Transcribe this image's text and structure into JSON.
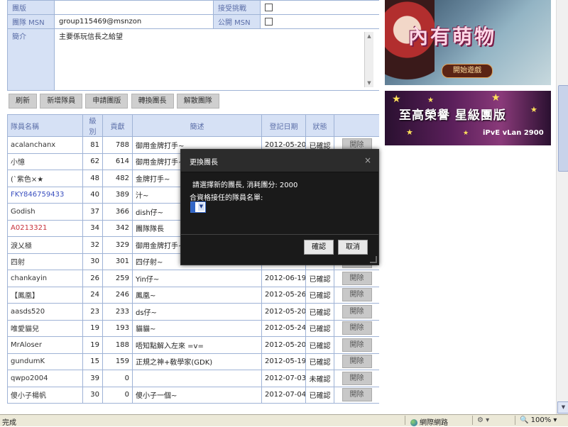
{
  "info": {
    "group_label": "團版",
    "group_value": "",
    "accept_challenge_label": "接受挑戰",
    "msn_label": "團隊 MSN",
    "msn_value": "group115469@msnzon",
    "public_msn_label": "公開 MSN",
    "intro_label": "簡介",
    "intro_value": "主要係玩信長之給望"
  },
  "toolbar": {
    "refresh": "刷新",
    "add_member": "新增隊員",
    "apply_board": "申請團版",
    "transfer_leader": "轉換團長",
    "disband": "解散團隊"
  },
  "members": {
    "headers": [
      "隊員名稱",
      "級別",
      "貢獻",
      "簡述",
      "登記日期",
      "狀態",
      ""
    ],
    "kick_label": "開除",
    "rows": [
      {
        "name": "acalanchanx",
        "level": "81",
        "contrib": "788",
        "desc": "御用金牌打手~",
        "date": "2012-05-20",
        "status": "已確認",
        "name_color": "#333333"
      },
      {
        "name": "小憶",
        "level": "62",
        "contrib": "614",
        "desc": "御用金牌打手~",
        "date": "",
        "status": "",
        "name_color": "#333333"
      },
      {
        "name": "(ˋ紫色×★",
        "level": "48",
        "contrib": "482",
        "desc": "金牌打手~",
        "date": "",
        "status": "",
        "name_color": "#333333"
      },
      {
        "name": "FKY846759433",
        "level": "40",
        "contrib": "389",
        "desc": "汁~",
        "date": "",
        "status": "",
        "name_color": "#3a4fbf"
      },
      {
        "name": "Godish",
        "level": "37",
        "contrib": "366",
        "desc": "dish仔~",
        "date": "",
        "status": "",
        "name_color": "#333333"
      },
      {
        "name": "A0213321",
        "level": "34",
        "contrib": "342",
        "desc": "團隊隊長",
        "date": "",
        "status": "",
        "name_color": "#c8323c"
      },
      {
        "name": "淚乂極",
        "level": "32",
        "contrib": "329",
        "desc": "御用金牌打手~",
        "date": "",
        "status": "",
        "name_color": "#333333"
      },
      {
        "name": "四射",
        "level": "30",
        "contrib": "301",
        "desc": "四仔射~",
        "date": "",
        "status": "",
        "name_color": "#333333"
      },
      {
        "name": "chankayin",
        "level": "26",
        "contrib": "259",
        "desc": "Yin仔~",
        "date": "2012-06-19",
        "status": "已確認",
        "name_color": "#333333"
      },
      {
        "name": "【鳳凰】",
        "level": "24",
        "contrib": "246",
        "desc": "鳳凰~",
        "date": "2012-05-26",
        "status": "已確認",
        "name_color": "#333333"
      },
      {
        "name": "aasds520",
        "level": "23",
        "contrib": "233",
        "desc": "ds仔~",
        "date": "2012-05-20",
        "status": "已確認",
        "name_color": "#333333"
      },
      {
        "name": "唯愛貓兒",
        "level": "19",
        "contrib": "193",
        "desc": "貓貓~",
        "date": "2012-05-24",
        "status": "已確認",
        "name_color": "#333333"
      },
      {
        "name": "MrAloser",
        "level": "19",
        "contrib": "188",
        "desc": "唔知點解入左來 =v=",
        "date": "2012-05-20",
        "status": "已確認",
        "name_color": "#333333"
      },
      {
        "name": "gundumK",
        "level": "15",
        "contrib": "159",
        "desc": "正規之神+敎學家(GDK)",
        "date": "2012-05-19",
        "status": "已確認",
        "name_color": "#333333"
      },
      {
        "name": "qwpo2004",
        "level": "39",
        "contrib": "0",
        "desc": "",
        "date": "2012-07-03",
        "status": "未確認",
        "name_color": "#333333"
      },
      {
        "name": "傻小子楊帆",
        "level": "30",
        "contrib": "0",
        "desc": "傻小子一個~",
        "date": "2012-07-04",
        "status": "已確認",
        "name_color": "#333333"
      }
    ]
  },
  "dialog": {
    "title": "更換團長",
    "close": "×",
    "message": "請選擇新的團長, 消耗團分: 2000",
    "list_label": "合資格接任的隊員名單:",
    "confirm": "確認",
    "cancel": "取消"
  },
  "banners": {
    "b1_text": "內有萌物",
    "b1_button": "開始遊戲",
    "b2_text": "至高榮譽 星級團版",
    "b2_sub": "iPvE vLan 2900"
  },
  "statusbar": {
    "left": "完成",
    "zone": "網際網路",
    "zoom": "100%"
  }
}
